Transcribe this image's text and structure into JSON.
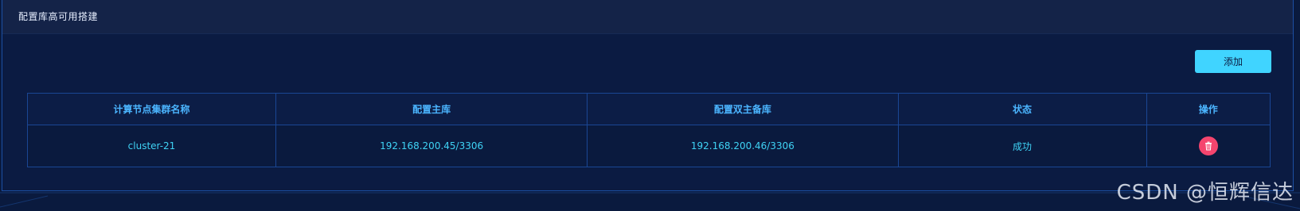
{
  "panel": {
    "title": "配置库高可用搭建"
  },
  "toolbar": {
    "add_label": "添加"
  },
  "table": {
    "columns": [
      "计算节点集群名称",
      "配置主库",
      "配置双主备库",
      "状态",
      "操作"
    ],
    "rows": [
      {
        "cluster": "cluster-21",
        "primary": "192.168.200.45/3306",
        "standby": "192.168.200.46/3306",
        "status": "成功",
        "action_icon": "trash-icon"
      }
    ]
  },
  "colors": {
    "accent": "#40d4ff",
    "danger": "#f5456e",
    "header_text": "#4bb5ff",
    "cell_text": "#3fd3f5"
  },
  "watermark": "CSDN @恒辉信达"
}
